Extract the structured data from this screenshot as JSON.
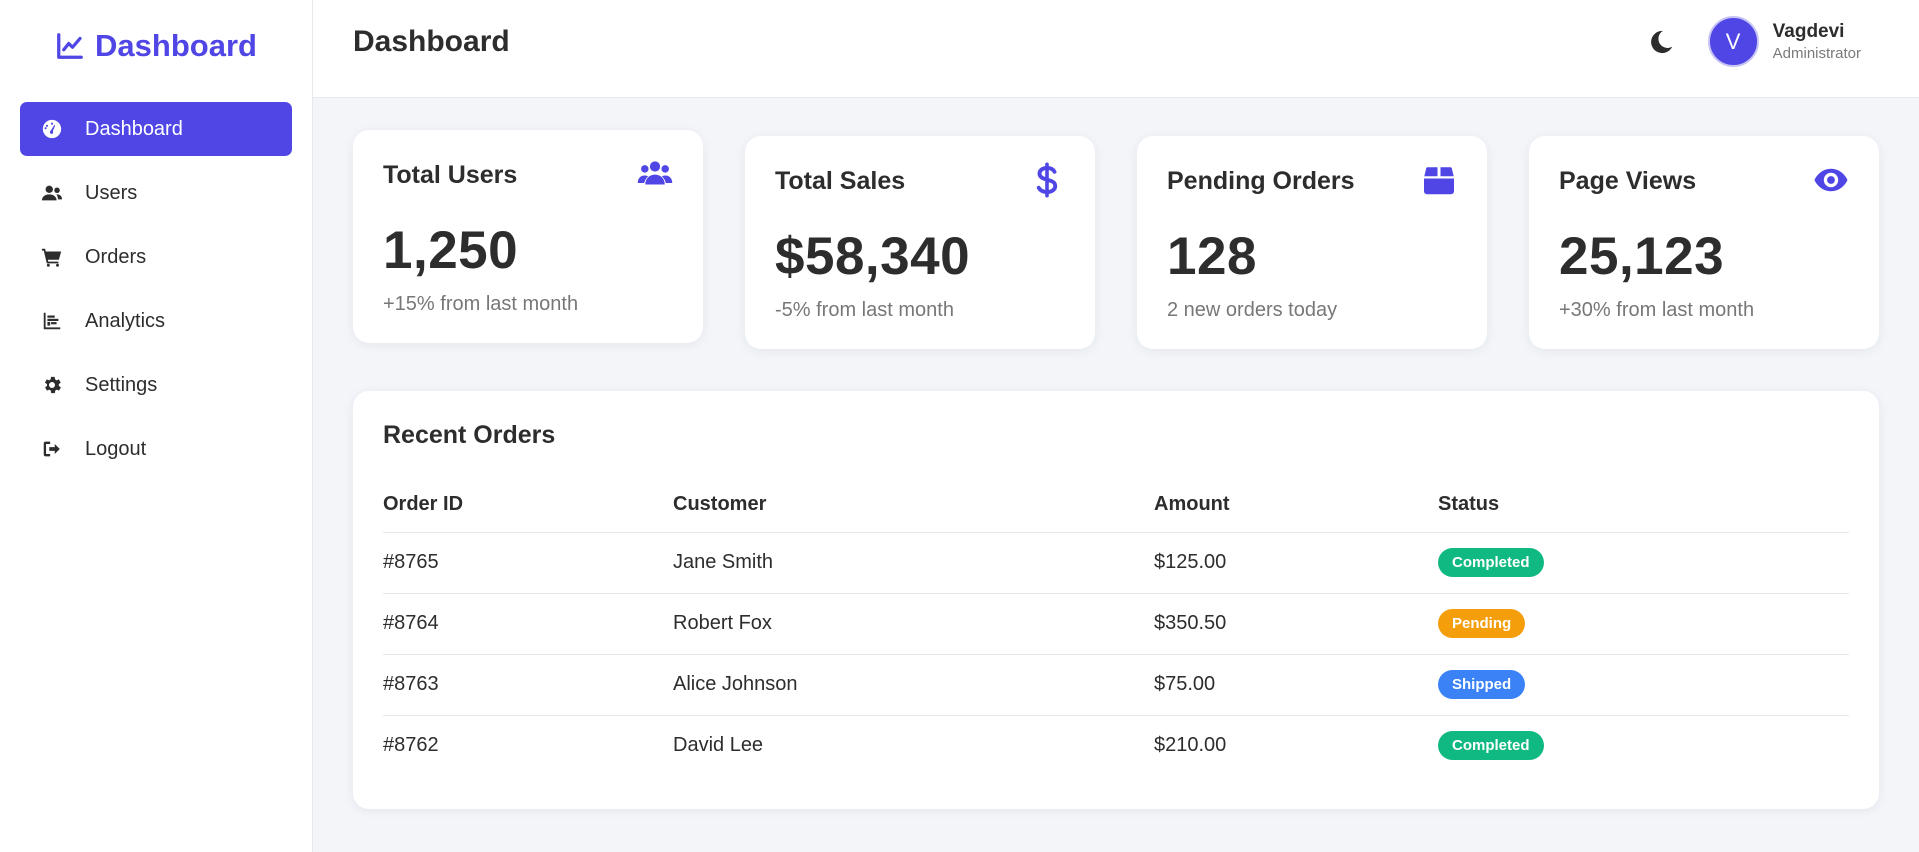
{
  "brand": {
    "label": "Dashboard",
    "icon": "chart-line-icon",
    "color": "#4f46e5"
  },
  "sidebar": {
    "items": [
      {
        "label": "Dashboard",
        "icon": "gauge-icon",
        "active": true
      },
      {
        "label": "Users",
        "icon": "users-icon"
      },
      {
        "label": "Orders",
        "icon": "cart-icon"
      },
      {
        "label": "Analytics",
        "icon": "bar-chart-icon"
      },
      {
        "label": "Settings",
        "icon": "gear-icon"
      },
      {
        "label": "Logout",
        "icon": "logout-icon"
      }
    ]
  },
  "header": {
    "title": "Dashboard",
    "theme_icon": "moon-icon",
    "user": {
      "initial": "V",
      "name": "Vagdevi",
      "role": "Administrator"
    }
  },
  "cards": [
    {
      "title": "Total Users",
      "value": "1,250",
      "sub": "+15% from last month",
      "icon": "users-icon"
    },
    {
      "title": "Total Sales",
      "value": "$58,340",
      "sub": "-5% from last month",
      "icon": "dollar-icon"
    },
    {
      "title": "Pending Orders",
      "value": "128",
      "sub": "2 new orders today",
      "icon": "box-icon"
    },
    {
      "title": "Page Views",
      "value": "25,123",
      "sub": "+30% from last month",
      "icon": "eye-icon"
    }
  ],
  "orders": {
    "title": "Recent Orders",
    "columns": [
      "Order ID",
      "Customer",
      "Amount",
      "Status"
    ],
    "rows": [
      {
        "id": "#8765",
        "customer": "Jane Smith",
        "amount": "$125.00",
        "status": "Completed",
        "color": "#10b981"
      },
      {
        "id": "#8764",
        "customer": "Robert Fox",
        "amount": "$350.50",
        "status": "Pending",
        "color": "#f59e0b"
      },
      {
        "id": "#8763",
        "customer": "Alice Johnson",
        "amount": "$75.00",
        "status": "Shipped",
        "color": "#3b82f6"
      },
      {
        "id": "#8762",
        "customer": "David Lee",
        "amount": "$210.00",
        "status": "Completed",
        "color": "#10b981"
      }
    ]
  }
}
